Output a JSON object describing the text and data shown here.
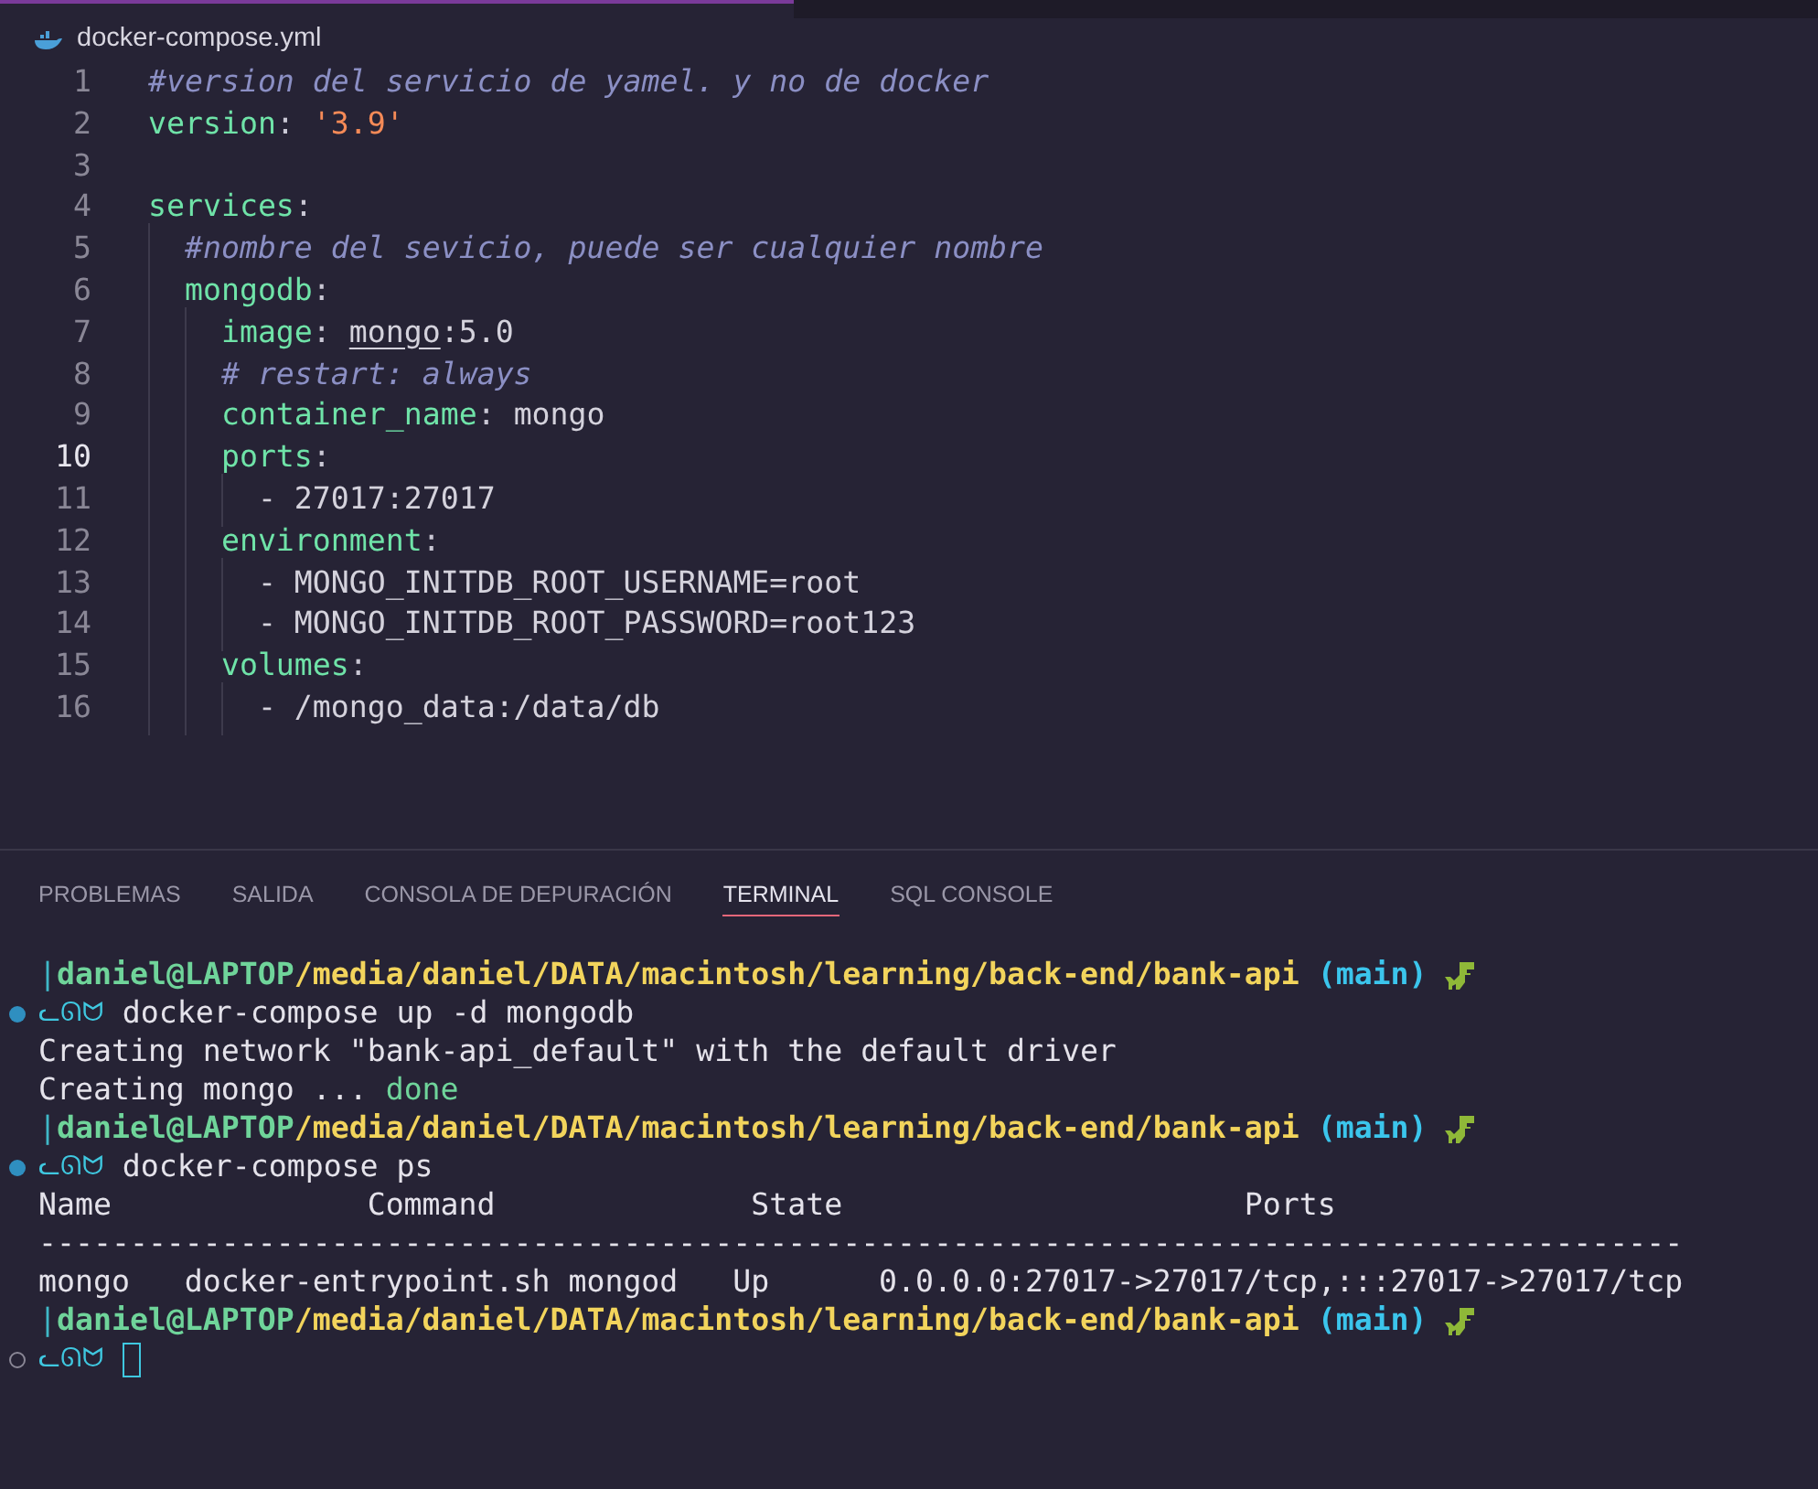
{
  "editor_tab": {
    "filename": "docker-compose.yml"
  },
  "code_lines": [
    {
      "number": "1",
      "current": false,
      "tokens": [
        {
          "kind": "comment",
          "text": "#version del servicio de yamel. y no de docker"
        }
      ]
    },
    {
      "number": "2",
      "current": false,
      "tokens": [
        {
          "kind": "key",
          "text": "version"
        },
        {
          "kind": "punct",
          "text": ": "
        },
        {
          "kind": "string",
          "text": "'3.9'"
        }
      ]
    },
    {
      "number": "3",
      "current": false
    },
    {
      "number": "4",
      "current": false,
      "tokens": [
        {
          "kind": "key",
          "text": "services"
        },
        {
          "kind": "punct",
          "text": ":"
        }
      ]
    },
    {
      "number": "5",
      "current": false,
      "tokens": [
        {
          "kind": "comment",
          "text": "  #nombre del sevicio, puede ser cualquier nombre"
        }
      ]
    },
    {
      "number": "6",
      "current": false,
      "tokens": [
        {
          "kind": "key",
          "text": "  mongodb"
        },
        {
          "kind": "punct",
          "text": ":"
        }
      ]
    },
    {
      "number": "7",
      "current": false,
      "tokens": [
        {
          "kind": "key",
          "text": "    image"
        },
        {
          "kind": "punct",
          "text": ": "
        },
        {
          "kind": "link",
          "text": "mongo"
        },
        {
          "kind": "plain",
          "text": ":5.0"
        }
      ]
    },
    {
      "number": "8",
      "current": false,
      "tokens": [
        {
          "kind": "comment",
          "text": "    # restart: always"
        }
      ]
    },
    {
      "number": "9",
      "current": false,
      "tokens": [
        {
          "kind": "key",
          "text": "    container_name"
        },
        {
          "kind": "punct",
          "text": ": "
        },
        {
          "kind": "plain",
          "text": "mongo"
        }
      ]
    },
    {
      "number": "10",
      "current": true,
      "tokens": [
        {
          "kind": "key",
          "text": "    ports"
        },
        {
          "kind": "punct",
          "text": ":"
        }
      ]
    },
    {
      "number": "11",
      "current": false,
      "tokens": [
        {
          "kind": "plain",
          "text": "      - 27017:27017"
        }
      ]
    },
    {
      "number": "12",
      "current": false,
      "tokens": [
        {
          "kind": "key",
          "text": "    environment"
        },
        {
          "kind": "punct",
          "text": ":"
        }
      ]
    },
    {
      "number": "13",
      "current": false,
      "tokens": [
        {
          "kind": "plain",
          "text": "      - MONGO_INITDB_ROOT_USERNAME=root"
        }
      ]
    },
    {
      "number": "14",
      "current": false,
      "tokens": [
        {
          "kind": "plain",
          "text": "      - MONGO_INITDB_ROOT_PASSWORD=root123"
        }
      ]
    },
    {
      "number": "15",
      "current": false,
      "tokens": [
        {
          "kind": "key",
          "text": "    volumes"
        },
        {
          "kind": "punct",
          "text": ":"
        }
      ]
    },
    {
      "number": "16",
      "current": false,
      "tokens": [
        {
          "kind": "plain",
          "text": "      - /mongo_data:/data/db"
        }
      ]
    }
  ],
  "panel_tabs": [
    {
      "label": "PROBLEMAS",
      "selected": false
    },
    {
      "label": "SALIDA",
      "selected": false
    },
    {
      "label": "CONSOLA DE DEPURACIÓN",
      "selected": false
    },
    {
      "label": "TERMINAL",
      "selected": true
    },
    {
      "label": "SQL CONSOLE",
      "selected": false
    }
  ],
  "terminal_lines": [
    {
      "kind": "prompt",
      "bar": "|",
      "user": "daniel@LAPTOP",
      "path": "/media/daniel/DATA/macintosh/learning/back-end/bank-api",
      "branch": "(main)"
    },
    {
      "kind": "command",
      "finished": true,
      "symbol": "ᓚᘏᗢ",
      "text": "docker-compose up -d mongodb"
    },
    {
      "kind": "output",
      "segments": [
        {
          "kind": "plain",
          "text": "Creating network \"bank-api_default\" with the default driver"
        }
      ]
    },
    {
      "kind": "output",
      "segments": [
        {
          "kind": "plain",
          "text": "Creating mongo ... "
        },
        {
          "kind": "success",
          "text": "done"
        }
      ]
    },
    {
      "kind": "prompt",
      "bar": "|",
      "user": "daniel@LAPTOP",
      "path": "/media/daniel/DATA/macintosh/learning/back-end/bank-api",
      "branch": "(main)"
    },
    {
      "kind": "command",
      "finished": true,
      "symbol": "ᓚᘏᗢ",
      "text": "docker-compose ps"
    },
    {
      "kind": "output",
      "segments": [
        {
          "kind": "plain",
          "text": "Name              Command              State                      Ports"
        }
      ]
    },
    {
      "kind": "output",
      "segments": [
        {
          "kind": "plain",
          "text": "------------------------------------------------------------------------------------------"
        }
      ]
    },
    {
      "kind": "output",
      "segments": [
        {
          "kind": "plain",
          "text": "mongo   docker-entrypoint.sh mongod   Up      0.0.0.0:27017->27017/tcp,:::27017->27017/tcp"
        }
      ]
    },
    {
      "kind": "prompt",
      "bar": "|",
      "user": "daniel@LAPTOP",
      "path": "/media/daniel/DATA/macintosh/learning/back-end/bank-api",
      "branch": "(main)"
    },
    {
      "kind": "command",
      "finished": false,
      "symbol": "ᓚᘏᗢ",
      "cursor": true
    }
  ]
}
